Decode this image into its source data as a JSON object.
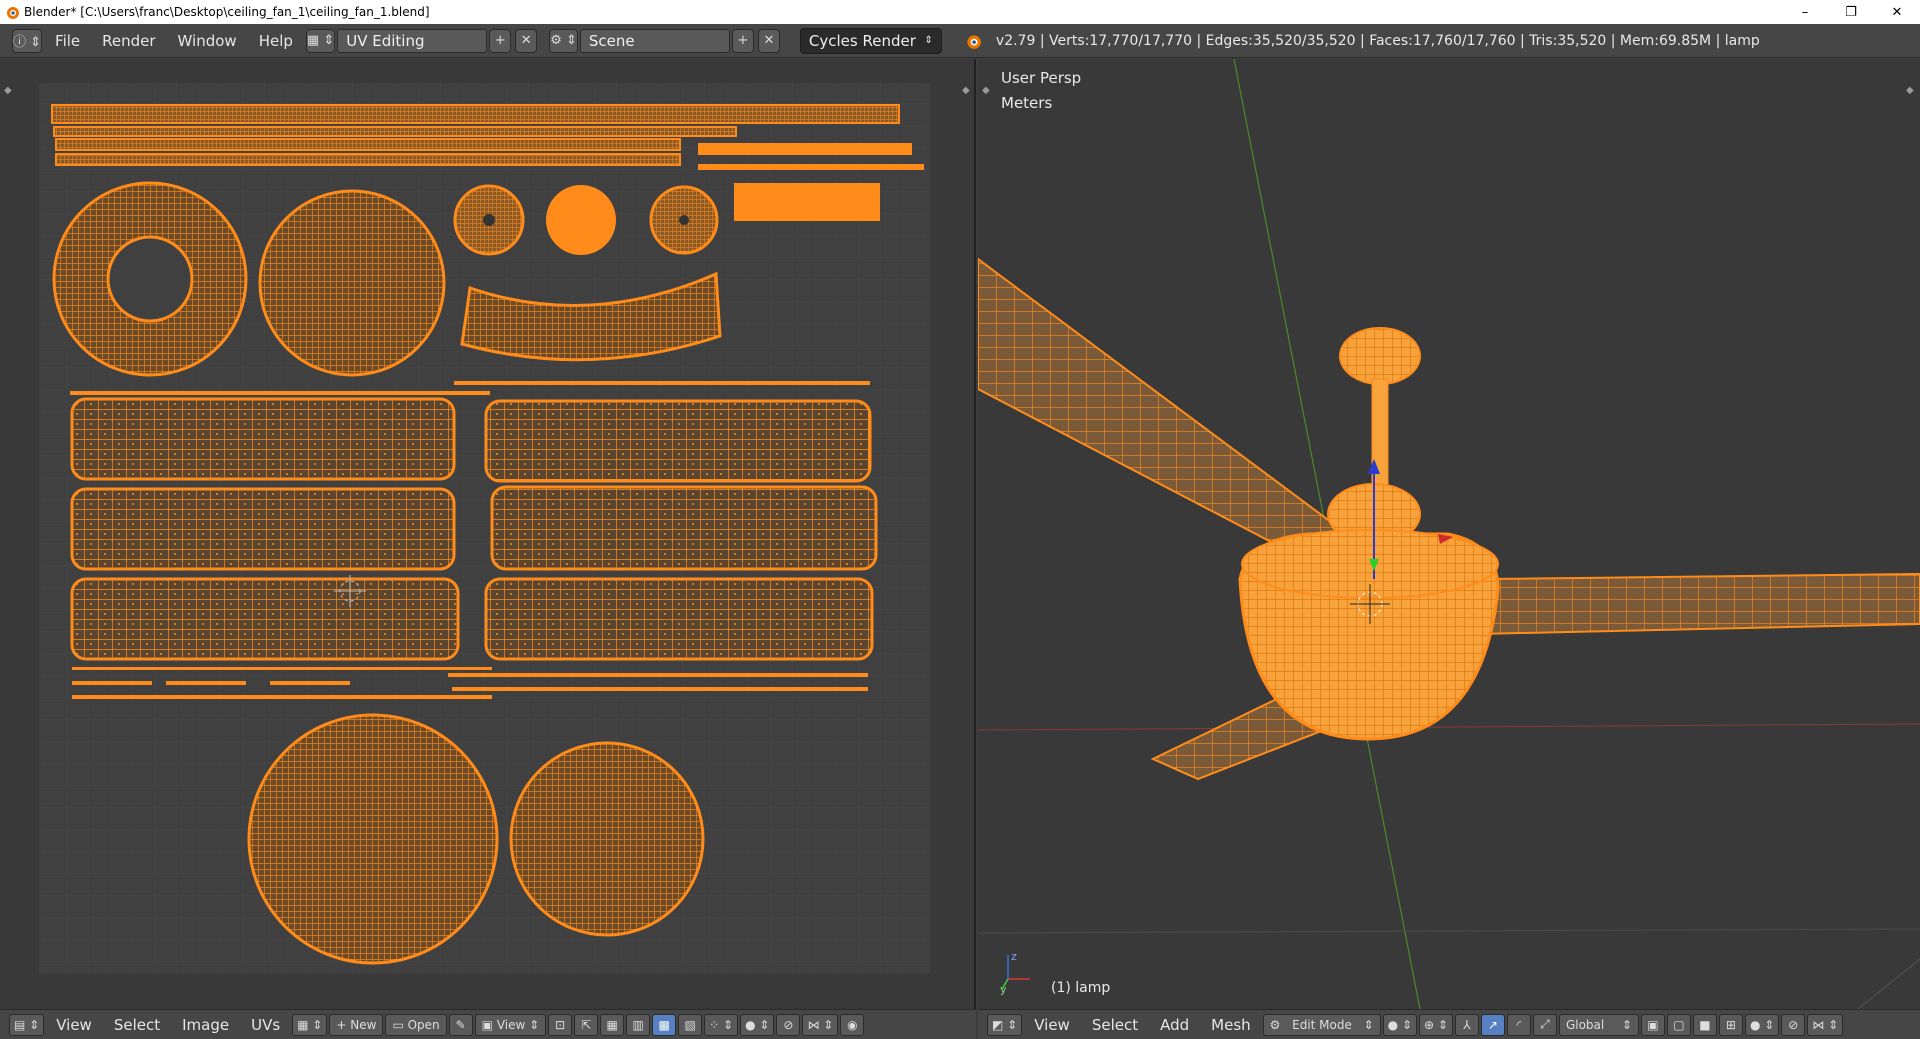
{
  "window": {
    "title": "Blender* [C:\\Users\\franc\\Desktop\\ceiling_fan_1\\ceiling_fan_1.blend]",
    "minimize": "–",
    "maximize": "❐",
    "close": "✕"
  },
  "info_header": {
    "menus": [
      "File",
      "Render",
      "Window",
      "Help"
    ],
    "screen_layout": "UV Editing",
    "scene": "Scene",
    "render_engine": "Cycles Render",
    "stats": "v2.79 | Verts:17,770/17,770 | Edges:35,520/35,520 | Faces:17,760/17,760 | Tris:35,520 | Mem:69.85M | lamp"
  },
  "viewport": {
    "view_name": "User Persp",
    "units": "Meters",
    "object_label": "(1) lamp",
    "axis_z": "z",
    "axis_y": "y"
  },
  "uv_header": {
    "menus": [
      "View",
      "Select",
      "Image",
      "UVs"
    ],
    "new_label": "New",
    "open_label": "Open",
    "view_label": "View"
  },
  "view3d_header": {
    "menus": [
      "View",
      "Select",
      "Add",
      "Mesh"
    ],
    "mode": "Edit Mode",
    "orientation": "Global"
  },
  "colors": {
    "mesh": "#ff8c1a",
    "background": "#393939",
    "grid": "#444444",
    "accent": "#5680c2"
  }
}
